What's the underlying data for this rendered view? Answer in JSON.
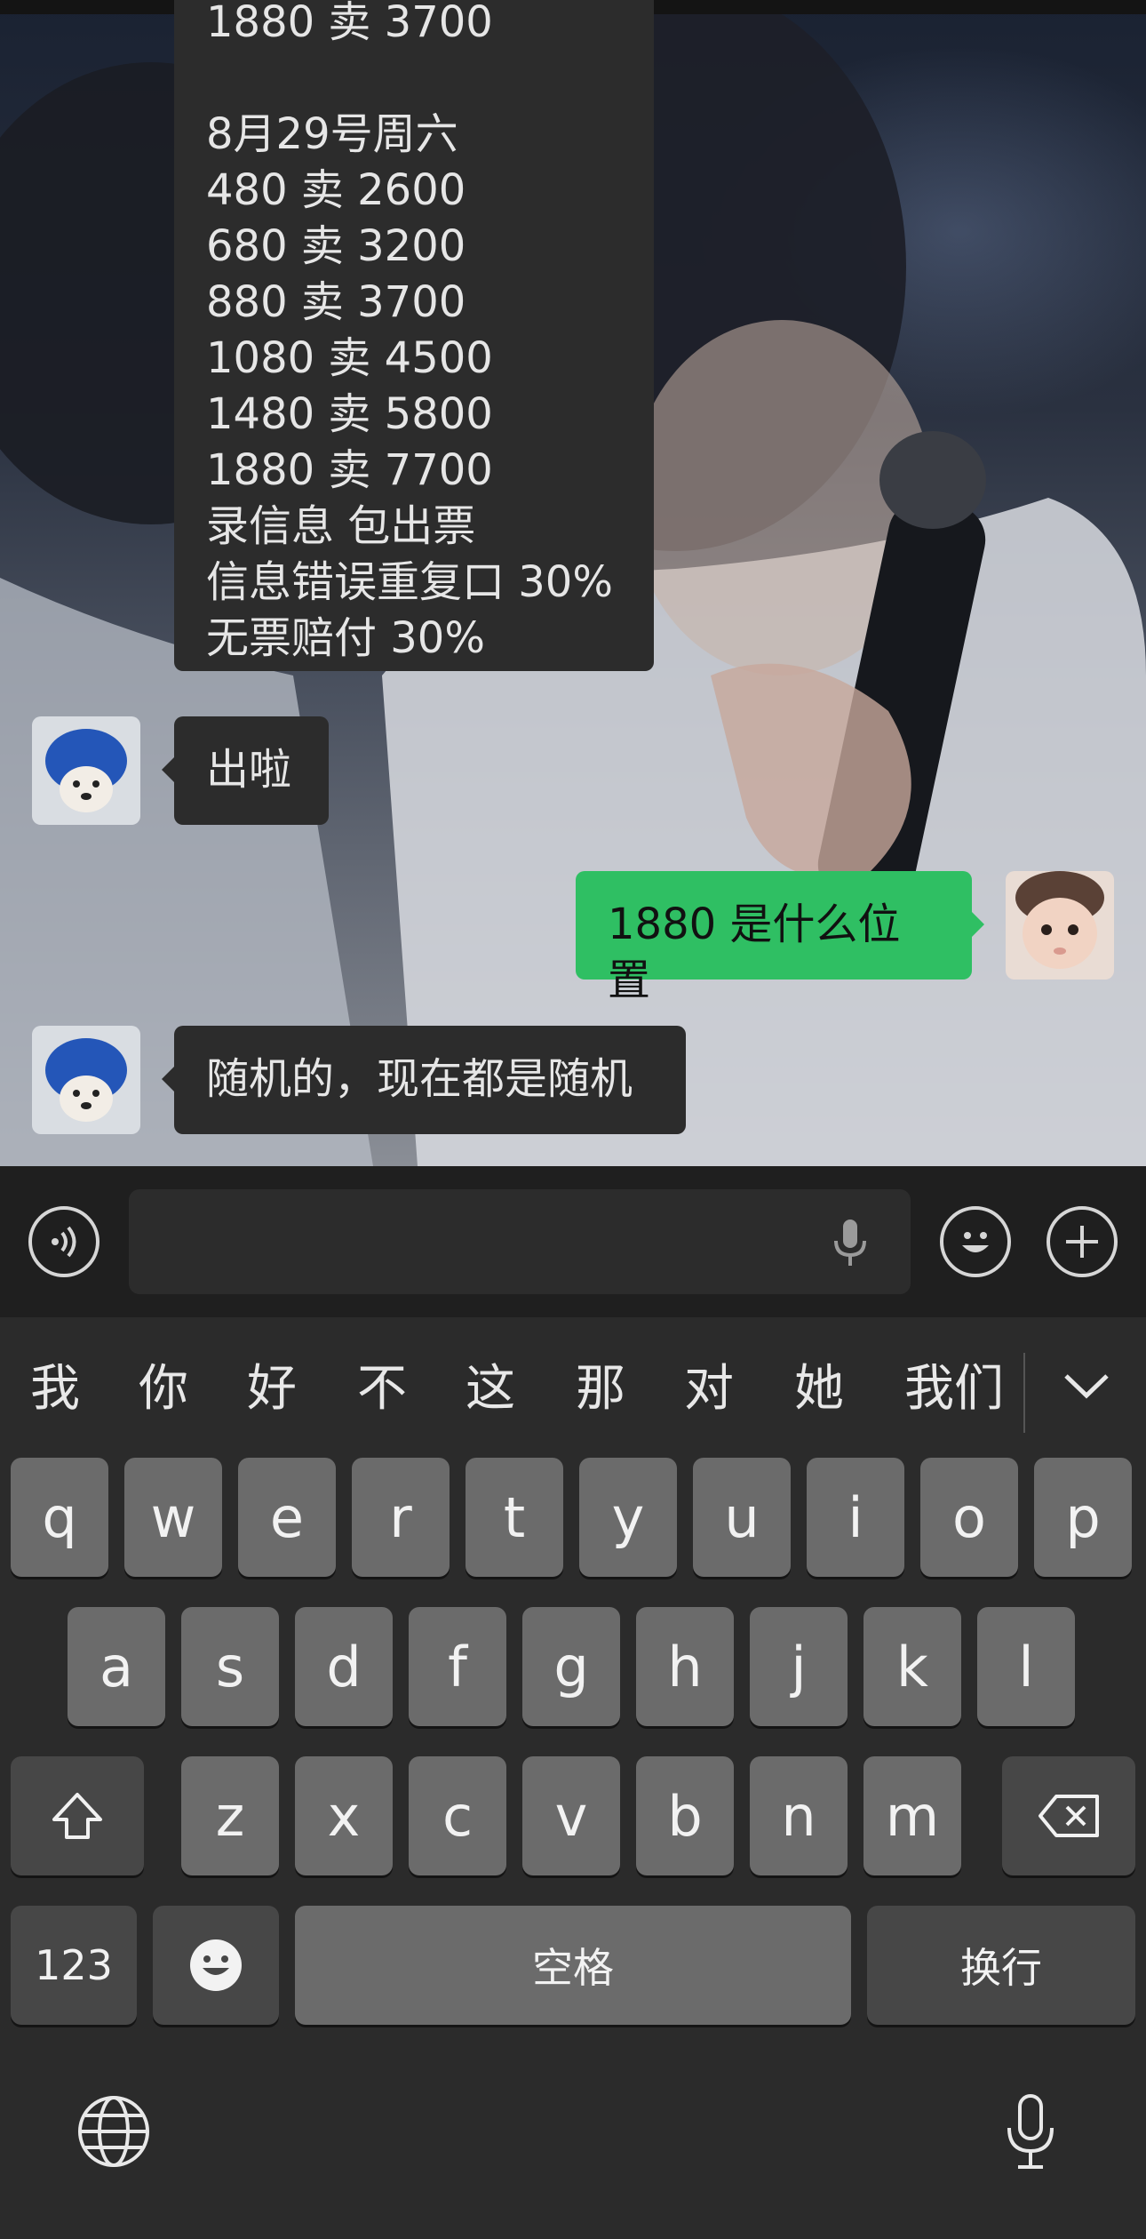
{
  "chat": {
    "price_list_partial_top": "1880 卖 3700",
    "price_list_lines": [
      "8月29号周六",
      "480 卖 2600",
      "680 卖 3200",
      "880 卖 3700",
      "1080 卖 4500",
      "1480 卖 5800",
      "1880 卖 7700",
      "录信息 包出票",
      "信息错误重复口 30%",
      "无票赔付 30%"
    ],
    "msg_out_label": "出啦",
    "msg_question": "1880 是什么位置",
    "msg_reply": "随机的，现在都是随机"
  },
  "input_bar": {
    "voice_icon": "voice-mode-icon",
    "mic_icon": "microphone-icon",
    "emoji_icon": "emoji-icon",
    "plus_icon": "plus-icon"
  },
  "keyboard": {
    "candidates": [
      "我",
      "你",
      "好",
      "不",
      "这",
      "那",
      "对",
      "她",
      "我们"
    ],
    "row1": [
      "q",
      "w",
      "e",
      "r",
      "t",
      "y",
      "u",
      "i",
      "o",
      "p"
    ],
    "row2": [
      "a",
      "s",
      "d",
      "f",
      "g",
      "h",
      "j",
      "k",
      "l"
    ],
    "row3": [
      "z",
      "x",
      "c",
      "v",
      "b",
      "n",
      "m"
    ],
    "numbers_label": "123",
    "space_label": "空格",
    "return_label": "换行",
    "colors": {
      "key": "#6b6b6b",
      "key_dark": "#474747",
      "bg": "#2b2b2b",
      "accent": "#2fbf63"
    }
  }
}
